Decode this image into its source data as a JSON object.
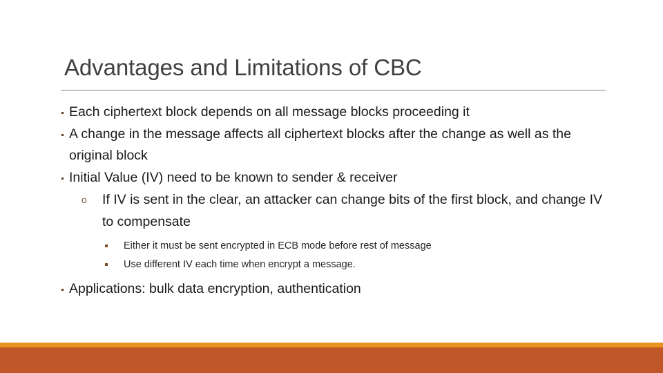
{
  "slide": {
    "title": "Advantages and Limitations of CBC",
    "background_color": "#FFFFFF",
    "title_color": "#404040",
    "rule_color": "#7F7F7F",
    "body_text_color": "#1A1A1A",
    "accent_bar_color": "#E8911C",
    "footer_bar_color": "#BF5729"
  },
  "body": {
    "bullets": [
      {
        "level": 1,
        "marker": "square-dot-marker",
        "text": "Each ciphertext block depends on all message blocks proceeding it"
      },
      {
        "level": 1,
        "marker": "square-dot-marker",
        "text": "A change in the message affects all ciphertext blocks after the change as well as the original block"
      },
      {
        "level": 1,
        "marker": "square-dot-marker",
        "text": "Initial Value (IV) need to be known to sender & receiver"
      },
      {
        "level": 2,
        "marker": "open-circle-marker",
        "marker_glyph": "o",
        "text": "If IV is sent in the clear, an attacker can change bits of the first block, and change IV to compensate"
      },
      {
        "level": 3,
        "marker": "filled-square-marker",
        "text": "Either it must be sent encrypted in ECB mode before rest of message"
      },
      {
        "level": 3,
        "marker": "filled-square-marker",
        "text": "Use different IV each time when encrypt a message."
      },
      {
        "level": 1,
        "marker": "square-dot-marker",
        "text": "Applications: bulk data encryption, authentication"
      }
    ]
  }
}
